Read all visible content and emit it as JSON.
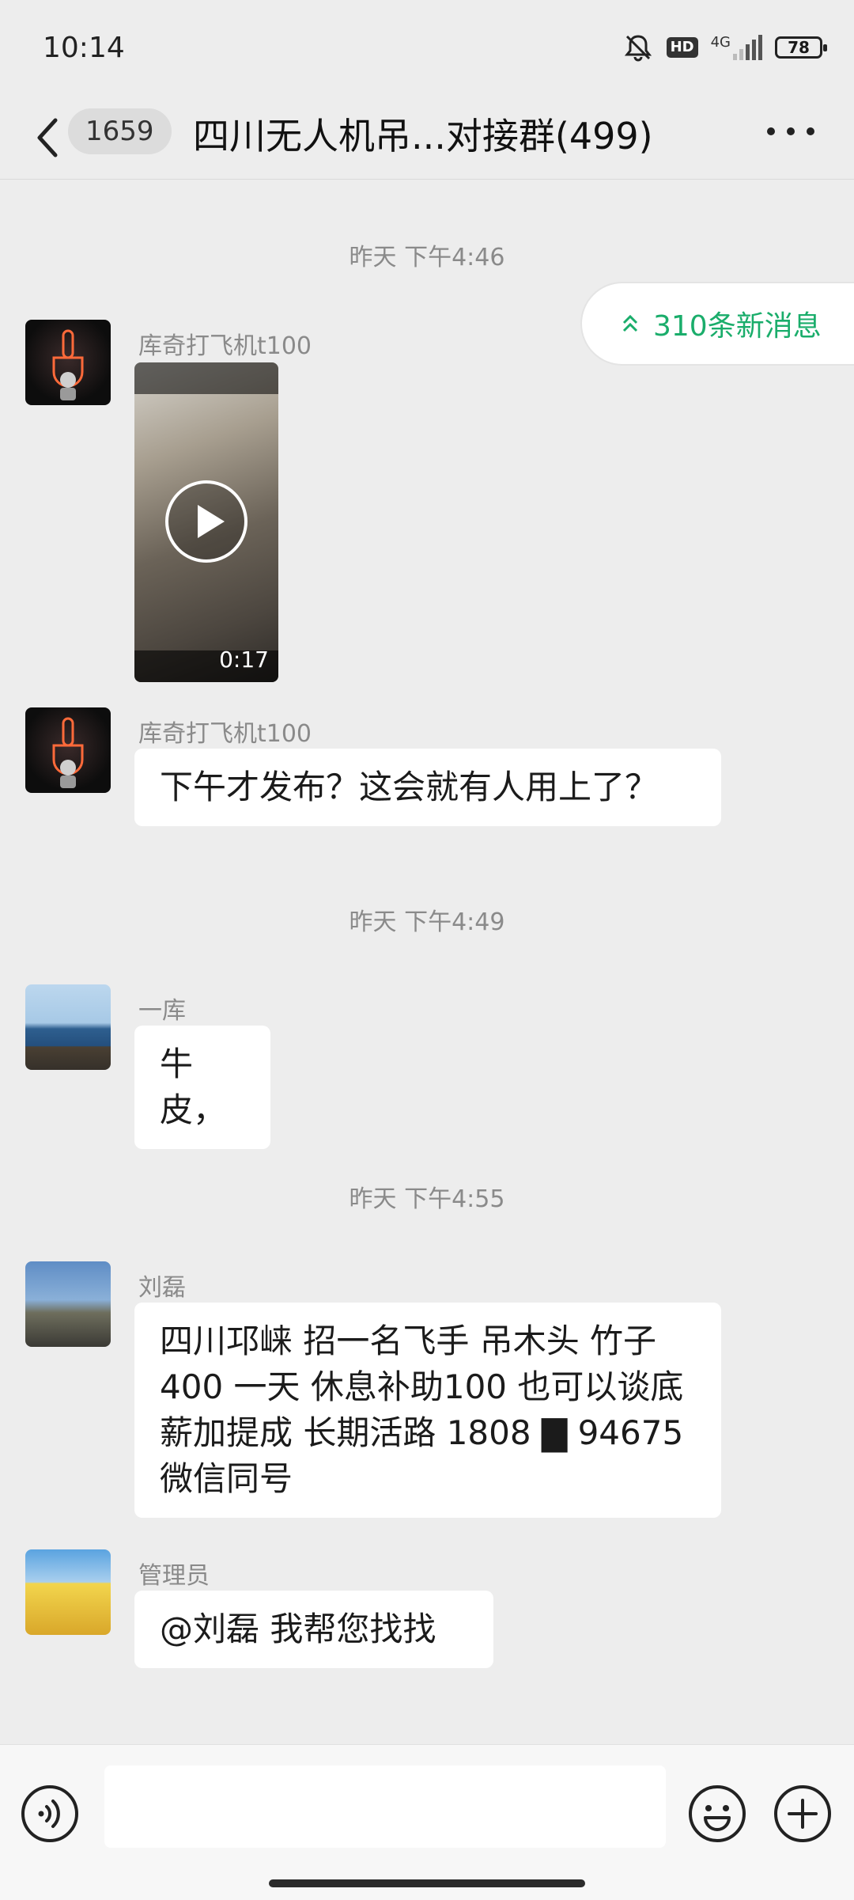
{
  "status_bar": {
    "time": "10:14",
    "hd": "HD",
    "network": "4G",
    "battery": "78",
    "icons": [
      "mute-icon",
      "hd-icon",
      "signal-icon",
      "battery-icon"
    ]
  },
  "header": {
    "unread_count": "1659",
    "title": "四川无人机吊...对接群(499)"
  },
  "new_messages": "310条新消息",
  "timestamps": [
    "昨天 下午4:46",
    "昨天 下午4:49",
    "昨天 下午4:55"
  ],
  "messages": [
    {
      "sender": "库奇打飞机t100",
      "type": "video",
      "duration": "0:17"
    },
    {
      "sender": "库奇打飞机t100",
      "text": "下午才发布？这会就有人用上了？"
    },
    {
      "sender": "一库",
      "text": "牛皮，"
    },
    {
      "sender": "刘磊",
      "lines": [
        "四川邛崃 招一名飞手 吊木头 竹子",
        "400 一天 休息补助100 也可以谈底",
        "薪加提成 长期活路 1808 ▇ 94675",
        "微信同号"
      ]
    },
    {
      "sender": "管理员",
      "text": "@刘磊  我帮您找找"
    }
  ],
  "input": {
    "placeholder": ""
  },
  "colors": {
    "accent": "#1aad6b",
    "background": "#ededed",
    "bubble": "#ffffff"
  }
}
